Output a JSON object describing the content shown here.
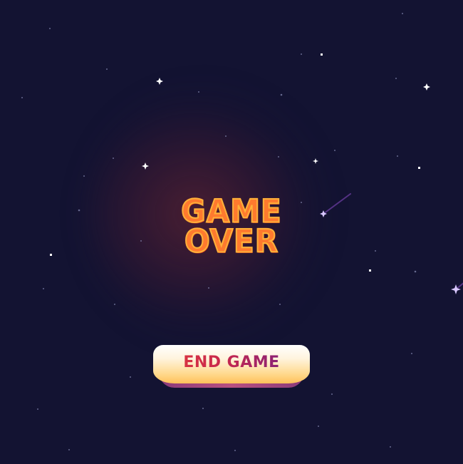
{
  "screen": {
    "title_line1": "GAME",
    "title_line2": "OVER"
  },
  "end_button": {
    "label": "END GAME"
  },
  "colors": {
    "background": "#131332",
    "title_fill": "#ff7a2e",
    "title_outline": "#ffb23a",
    "button_face": "#ffd98e",
    "button_text_start": "#e23a3a",
    "button_text_end": "#6a1e8a"
  }
}
